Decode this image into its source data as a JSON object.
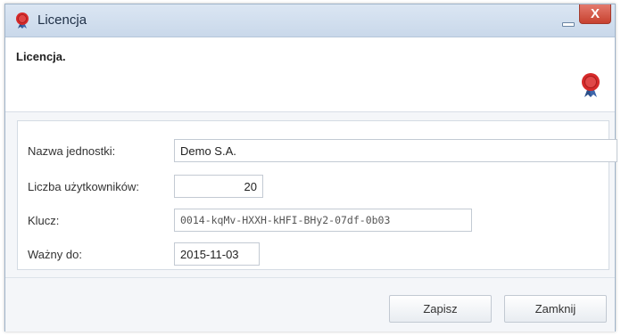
{
  "window": {
    "title": "Licencja",
    "close_label": "X"
  },
  "header": {
    "title": "Licencja."
  },
  "form": {
    "fields": [
      {
        "label": "Nazwa jednostki:",
        "value": "Demo S.A."
      },
      {
        "label": "Liczba użytkowników:",
        "value": "20"
      },
      {
        "label": "Klucz:",
        "value": "0014-kqMv-HXXH-kHFI-BHy2-07df-0b03"
      },
      {
        "label": "Ważny do:",
        "value": "2015-11-03"
      }
    ]
  },
  "footer": {
    "save_label": "Zapisz",
    "close_label": "Zamknij"
  },
  "icons": {
    "app": "wax-seal-icon",
    "minimize": "minimize-icon"
  },
  "colors": {
    "titlebar": "#c9d8ea",
    "close_button": "#c7412f",
    "seal": "#d62a2a"
  }
}
